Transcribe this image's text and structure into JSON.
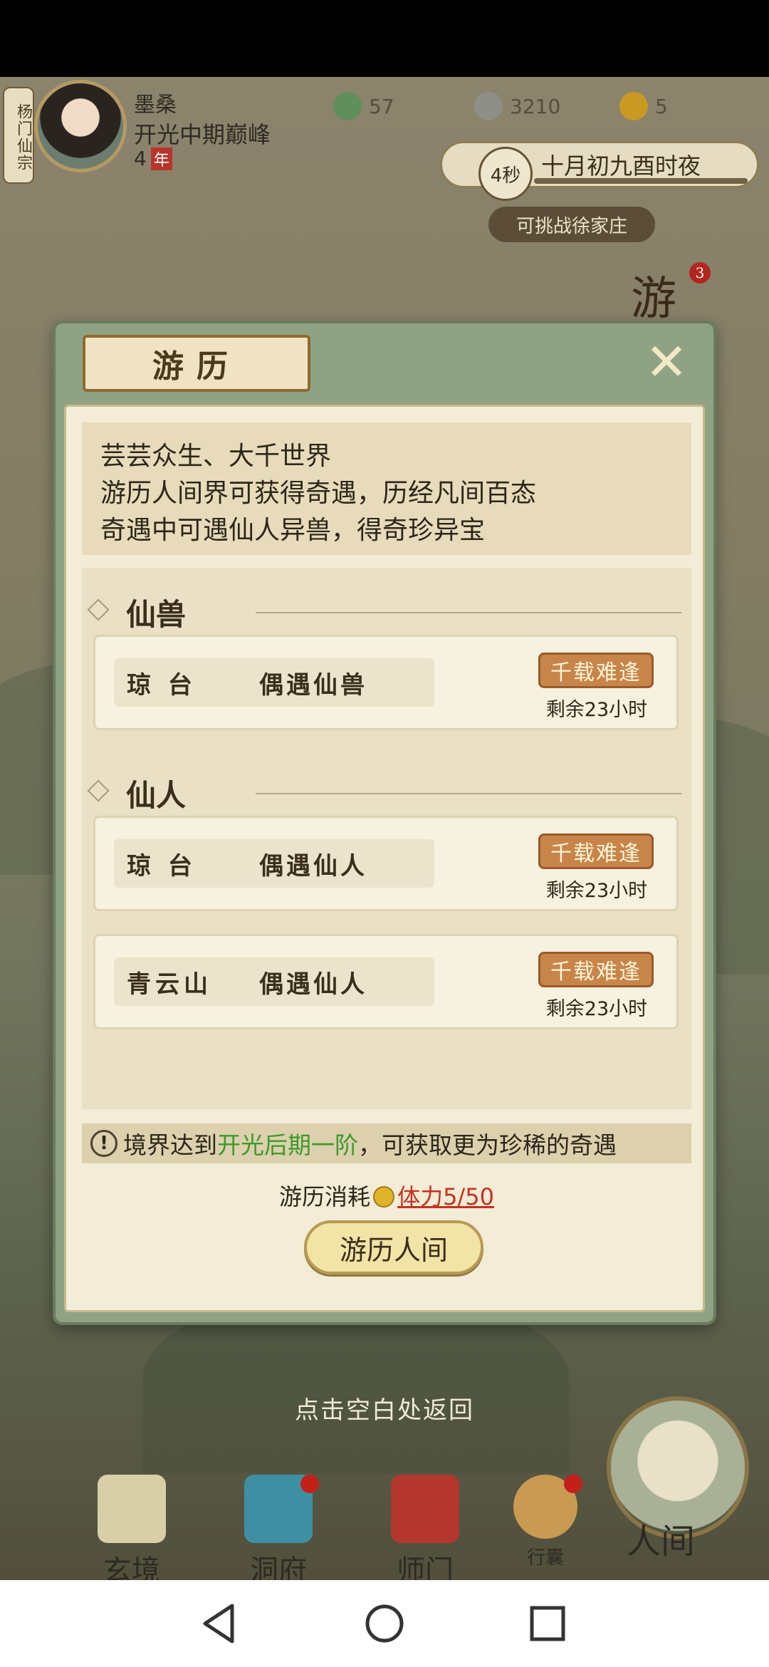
{
  "hud": {
    "sect_label": "杨门仙宗",
    "player_name": "墨桑",
    "realm": "开光中期巅峰",
    "age_value": "4",
    "age_unit": "年",
    "resource_1": "57",
    "resource_2": "3210",
    "resource_3": "5",
    "time_remaining": "4秒",
    "game_date": "十月初九酉时夜",
    "challenge": "可挑战徐家庄",
    "side_badge_char": "游",
    "side_badge_count": "3"
  },
  "modal": {
    "title": "游历",
    "close_symbol": "✕",
    "intro_lines": [
      "芸芸众生、大千世界",
      "游历人间界可获得奇遇，历经凡间百态",
      "奇遇中可遇仙人异兽，得奇珍异宝"
    ],
    "sections": [
      {
        "label": "仙兽",
        "events": [
          {
            "place": "琼 台",
            "kind": "偶遇仙兽",
            "rarity": "千载难逢",
            "remaining": "剩余23小时"
          }
        ]
      },
      {
        "label": "仙人",
        "events": [
          {
            "place": "琼 台",
            "kind": "偶遇仙人",
            "rarity": "千载难逢",
            "remaining": "剩余23小时"
          },
          {
            "place": "青云山",
            "kind": "偶遇仙人",
            "rarity": "千载难逢",
            "remaining": "剩余23小时"
          }
        ]
      }
    ],
    "notice_icon": "!",
    "notice_prefix": "境界达到",
    "notice_highlight": "开光后期一阶",
    "notice_suffix": "，可获取更为珍稀的奇遇",
    "cost_label": "游历消耗",
    "stamina": "体力5/50",
    "travel_button": "游历人间"
  },
  "return_hint": "点击空白处返回",
  "bottom_nav": {
    "items": [
      "玄境",
      "洞府",
      "师门",
      "行囊"
    ],
    "world": "人间"
  }
}
